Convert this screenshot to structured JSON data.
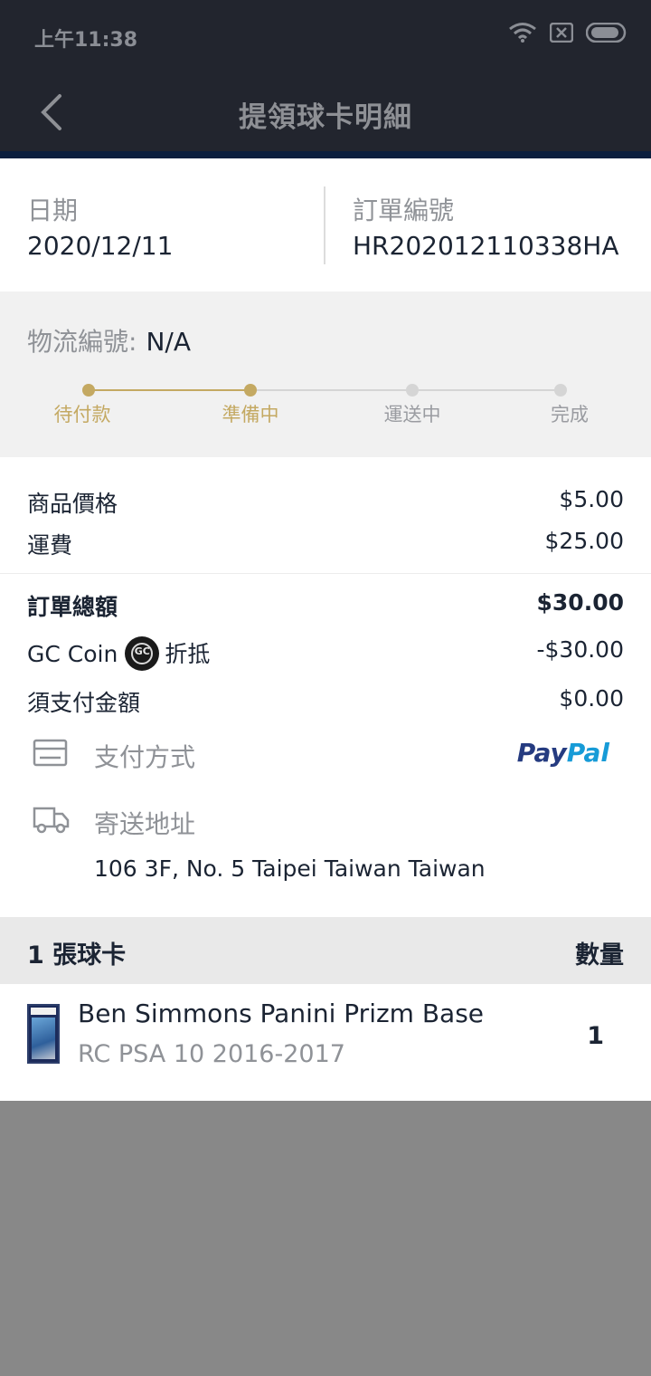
{
  "status_bar": {
    "time": "上午11:38"
  },
  "header": {
    "title": "提領球卡明細"
  },
  "info": {
    "date_label": "日期",
    "date_value": "2020/12/11",
    "order_label": "訂單編號",
    "order_value": "HR202012110338HA"
  },
  "logistics": {
    "label": "物流編號:",
    "value": "N/A",
    "steps": [
      "待付款",
      "準備中",
      "運送中",
      "完成"
    ],
    "completed_steps": 2,
    "active_color": "#c4a962",
    "inactive_color": "#d5d5d5"
  },
  "amounts": {
    "product_price_label": "商品價格",
    "product_price_value": "$5.00",
    "shipping_label": "運費",
    "shipping_value": "$25.00",
    "total_label": "訂單總額",
    "total_value": "$30.00",
    "coin_label": "GC Coin",
    "coin_suffix": "折抵",
    "coin_value": "-$30.00",
    "payable_label": "須支付金額",
    "payable_value": "$0.00"
  },
  "payment": {
    "label": "支付方式",
    "method_part1": "Pay",
    "method_part2": "Pal"
  },
  "shipping_address": {
    "label": "寄送地址",
    "value": "106 3F, No. 5 Taipei Taiwan Taiwan"
  },
  "cards": {
    "count_label": "1 張球卡",
    "qty_header": "數量",
    "items": [
      {
        "name": "Ben Simmons Panini Prizm Base",
        "subtitle": "RC PSA 10 2016-2017",
        "qty": "1"
      }
    ]
  }
}
